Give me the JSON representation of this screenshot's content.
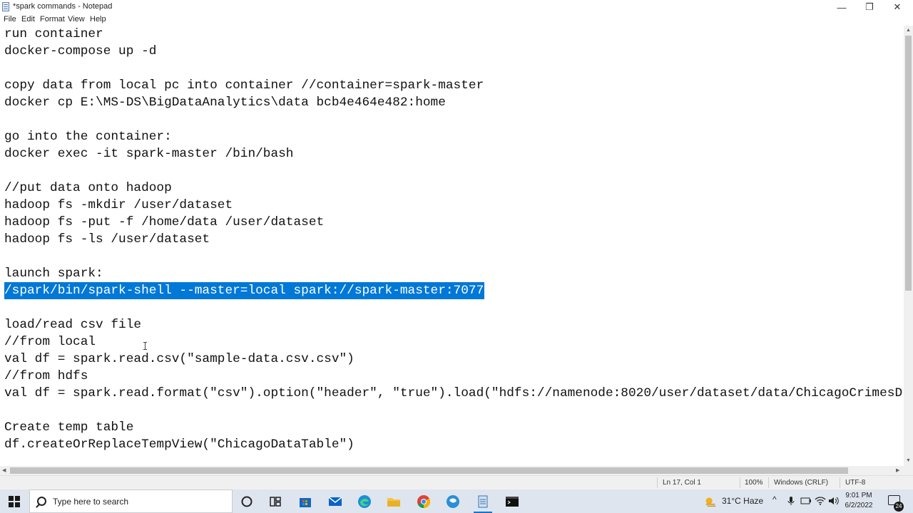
{
  "window": {
    "title": "*spark commands - Notepad",
    "minimize_glyph": "—",
    "maximize_glyph": "❐",
    "close_glyph": "✕"
  },
  "menu": [
    {
      "accel": "F",
      "rest": "ile"
    },
    {
      "accel": "E",
      "rest": "dit"
    },
    {
      "accel": "F",
      "rest": "ormat",
      "prefix": "F",
      "accel_after": "o"
    },
    {
      "accel": "V",
      "rest": "iew"
    },
    {
      "accel": "H",
      "rest": "elp"
    }
  ],
  "menu_labels": [
    "File",
    "Edit",
    "Format",
    "View",
    "Help"
  ],
  "editor": {
    "lines": [
      "run container",
      "docker-compose up -d",
      "",
      "copy data from local pc into container //container=spark-master",
      "docker cp E:\\MS-DS\\BigDataAnalytics\\data bcb4e464e482:home",
      "",
      "go into the container:",
      "docker exec -it spark-master /bin/bash",
      "",
      "//put data onto hadoop",
      "hadoop fs -mkdir /user/dataset",
      "hadoop fs -put -f /home/data /user/dataset",
      "hadoop fs -ls /user/dataset",
      "",
      "launch spark:",
      "/spark/bin/spark-shell --master=local spark://spark-master:7077",
      "",
      "load/read csv file",
      "//from local",
      "val df = spark.read.csv(\"sample-data.csv.csv\")",
      "//from hdfs",
      "val df = spark.read.format(\"csv\").option(\"header\", \"true\").load(\"hdfs://namenode:8020/user/dataset/data/ChicagoCrimesD",
      "",
      "Create temp table",
      "df.createOrReplaceTempView(\"ChicagoDataTable\")"
    ],
    "selected_line_index": 15
  },
  "status": {
    "position": "Ln 17, Col 1",
    "zoom": "100%",
    "line_ending": "Windows (CRLF)",
    "encoding": "UTF-8"
  },
  "taskbar": {
    "search_placeholder": "Type here to search",
    "apps": [
      "cortana-icon",
      "task-view-icon",
      "store-icon",
      "mail-icon",
      "edge-icon",
      "file-explorer-icon",
      "chrome-icon",
      "dbeaver-icon",
      "notepad-icon",
      "terminal-icon"
    ],
    "weather": "31°C  Haze",
    "time": "9:01 PM",
    "date": "6/2/2022",
    "notification_count": "24"
  },
  "colors": {
    "selection": "#0078d7",
    "taskbar": "#dfe5ee"
  }
}
